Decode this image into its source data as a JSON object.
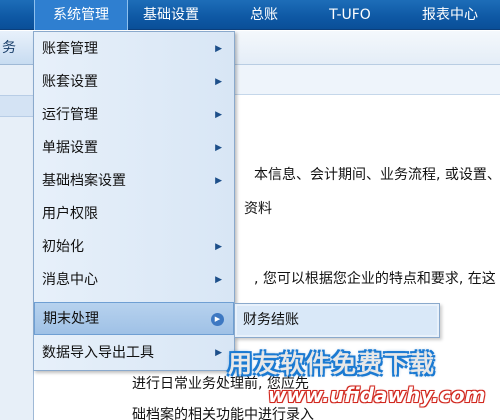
{
  "menubar": {
    "items": [
      {
        "label": "系统管理",
        "active": true
      },
      {
        "label": "基础设置",
        "active": false
      },
      {
        "label": "总账",
        "active": false
      },
      {
        "label": "T-UFO",
        "active": false
      },
      {
        "label": "报表中心",
        "active": false
      }
    ]
  },
  "left_strip": {
    "tab_label": "务"
  },
  "dropdown": {
    "items": [
      {
        "label": "账套管理",
        "has_submenu": true
      },
      {
        "label": "账套设置",
        "has_submenu": true
      },
      {
        "label": "运行管理",
        "has_submenu": true
      },
      {
        "label": "单据设置",
        "has_submenu": true
      },
      {
        "label": "基础档案设置",
        "has_submenu": true
      },
      {
        "label": "用户权限",
        "has_submenu": false
      },
      {
        "label": "初始化",
        "has_submenu": true
      },
      {
        "label": "消息中心",
        "has_submenu": true
      },
      {
        "label": "期末处理",
        "has_submenu": true,
        "active": true
      },
      {
        "label": "数据导入导出工具",
        "has_submenu": true
      }
    ],
    "arrow_icon": "triangle-right-icon",
    "active_arrow_icon": "circle-arrow-right-icon"
  },
  "submenu": {
    "items": [
      {
        "label": "财务结账"
      }
    ]
  },
  "content": {
    "lines": [
      "本信息、会计期间、业务流程, 或设置、",
      "资料",
      ", 您可以根据您企业的特点和要求, 在这",
      "进行日常业务处理前, 您应先",
      "础档案的相关功能中进行录入"
    ]
  },
  "watermark": {
    "logo_text": "用友软件免费下载",
    "url_text": "www.ufidawhy.com",
    "colors": {
      "logo_outline": "#1b7ad2",
      "url_outline": "#d1281f"
    }
  },
  "colors": {
    "menubar_bg": "#0e58a4",
    "menu_active_bg": "#2f7fd0",
    "dropdown_bg": "#e7f0fa",
    "dropdown_active_bg": "#b7d2ee"
  }
}
